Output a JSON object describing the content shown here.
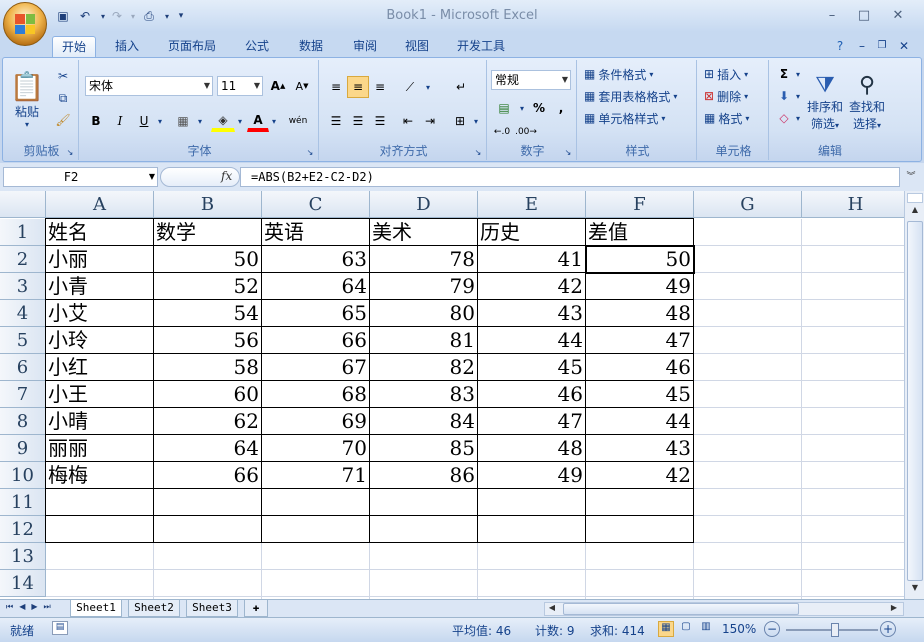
{
  "window": {
    "title": "Book1 - Microsoft Excel",
    "minimize": "–",
    "maximize": "□",
    "close": "✕"
  },
  "ribbon_tabs": [
    "开始",
    "插入",
    "页面布局",
    "公式",
    "数据",
    "审阅",
    "视图",
    "开发工具"
  ],
  "clipboard": {
    "paste_label": "粘贴",
    "group_label": "剪贴板"
  },
  "font": {
    "font_name": "宋体",
    "font_size": "11",
    "bold": "B",
    "italic": "I",
    "underline": "U",
    "phonetic": "wén",
    "group_label": "字体"
  },
  "alignment": {
    "group_label": "对齐方式"
  },
  "number": {
    "format": "常规",
    "percent": "%",
    "comma": ",",
    "group_label": "数字"
  },
  "styles": {
    "conditional": "条件格式",
    "table_format": "套用表格格式",
    "cell_style": "单元格样式",
    "group_label": "样式"
  },
  "cells_group": {
    "insert": "插入",
    "delete": "删除",
    "format": "格式",
    "group_label": "单元格"
  },
  "editing": {
    "sum_icon": "Σ",
    "sort_line1": "排序和",
    "sort_line2": "筛选",
    "find_line1": "查找和",
    "find_line2": "选择",
    "group_label": "编辑"
  },
  "formula_bar": {
    "name_box": "F2",
    "fx": "fx",
    "formula": "=ABS(B2+E2-C2-D2)"
  },
  "columns": [
    "A",
    "B",
    "C",
    "D",
    "E",
    "F",
    "G",
    "H"
  ],
  "rows": [
    "1",
    "2",
    "3",
    "4",
    "5",
    "6",
    "7",
    "8",
    "9",
    "10",
    "11",
    "12",
    "13",
    "14"
  ],
  "table": {
    "header": [
      "姓名",
      "数学",
      "英语",
      "美术",
      "历史",
      "差值"
    ],
    "data": [
      [
        "小丽",
        "50",
        "63",
        "78",
        "41",
        "50"
      ],
      [
        "小青",
        "52",
        "64",
        "79",
        "42",
        "49"
      ],
      [
        "小艾",
        "54",
        "65",
        "80",
        "43",
        "48"
      ],
      [
        "小玲",
        "56",
        "66",
        "81",
        "44",
        "47"
      ],
      [
        "小红",
        "58",
        "67",
        "82",
        "45",
        "46"
      ],
      [
        "小王",
        "60",
        "68",
        "83",
        "46",
        "45"
      ],
      [
        "小晴",
        "62",
        "69",
        "84",
        "47",
        "44"
      ],
      [
        "丽丽",
        "64",
        "70",
        "85",
        "48",
        "43"
      ],
      [
        "梅梅",
        "66",
        "71",
        "86",
        "49",
        "42"
      ]
    ]
  },
  "sheet_tabs": [
    "Sheet1",
    "Sheet2",
    "Sheet3"
  ],
  "status": {
    "ready": "就绪",
    "average": "平均值: 46",
    "count": "计数: 9",
    "sum": "求和: 414",
    "zoom": "150%"
  },
  "colors": {
    "accent": "#15428b",
    "ribbon_bg": "#d4e2f4",
    "grid": "#d0d7e5"
  }
}
